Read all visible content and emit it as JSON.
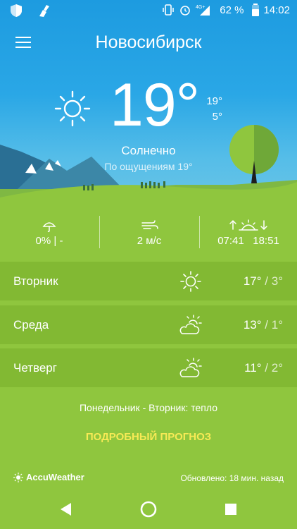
{
  "status_bar": {
    "battery": "62 %",
    "time": "14:02",
    "network": "4G+"
  },
  "header": {
    "city": "Новосибирск"
  },
  "current": {
    "temperature": "19°",
    "high": "19°",
    "low": "5°",
    "condition": "Солнечно",
    "feels_like": "По ощущениям 19°",
    "icon": "sun-icon"
  },
  "stats": {
    "precipitation": "0% | -",
    "wind": "2 м/с",
    "sunrise": "07:41",
    "sunset": "18:51"
  },
  "forecast": [
    {
      "day": "Вторник",
      "high": "17°",
      "sep": "/",
      "low": "3°",
      "icon": "sun-icon"
    },
    {
      "day": "Среда",
      "high": "13°",
      "sep": "/",
      "low": "1°",
      "icon": "partly-cloudy-icon"
    },
    {
      "day": "Четверг",
      "high": "11°",
      "sep": "/",
      "low": "2°",
      "icon": "partly-cloudy-icon"
    }
  ],
  "summary": "Понедельник - Вторник: тепло",
  "more_link": "ПОДРОБНЫЙ ПРОГНОЗ",
  "footer": {
    "brand": "AccuWeather",
    "updated": "Обновлено: 18 мин. назад"
  },
  "colors": {
    "sky": "#1d9be0",
    "grass": "#8fc63e",
    "row": "#82b933",
    "accent": "#f7ea55"
  }
}
